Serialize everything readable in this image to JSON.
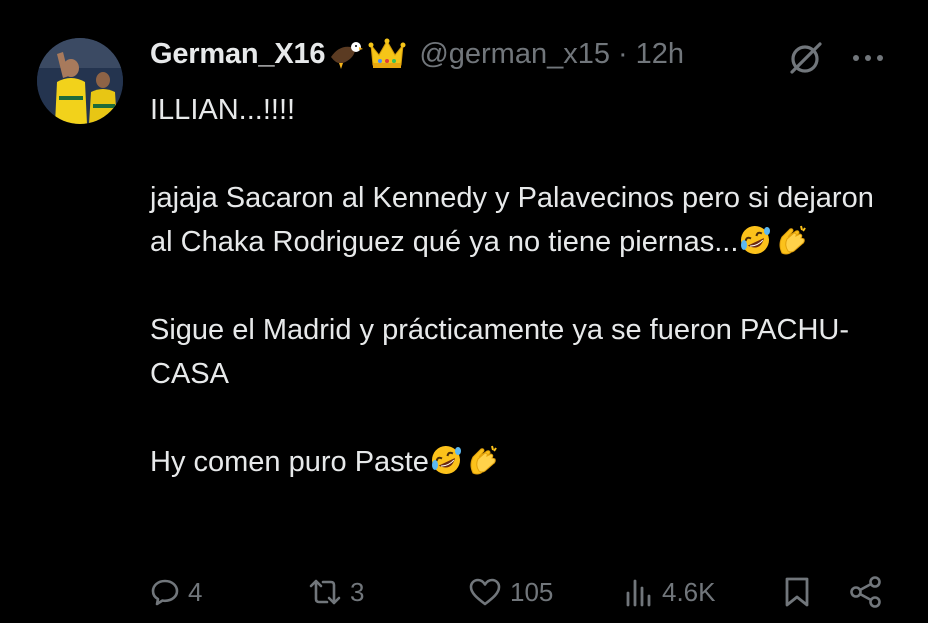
{
  "tweet": {
    "display_name": "German_X16",
    "handle": "@german_x15",
    "separator": "·",
    "time": "12h",
    "paragraphs": [
      "ILLIAN...!!!!",
      "jajaja Sacaron al Kennedy y Palavecinos pero si dejaron al Chaka Rodriguez qué ya no tiene piernas...",
      "Sigue el Madrid y prácticamente ya se fueron PACHU-CASA",
      "Hy comen puro Paste"
    ],
    "emojis": [
      "rolling-on-floor-laughing",
      "clapping-hands"
    ],
    "badges": [
      "eagle-icon",
      "crown-icon"
    ]
  },
  "actions": {
    "replies": "4",
    "reposts": "3",
    "likes": "105",
    "views": "4.6K"
  },
  "colors": {
    "background": "#000000",
    "text": "#e7e9ea",
    "secondary": "#71767b",
    "crown": "#f5c518"
  }
}
